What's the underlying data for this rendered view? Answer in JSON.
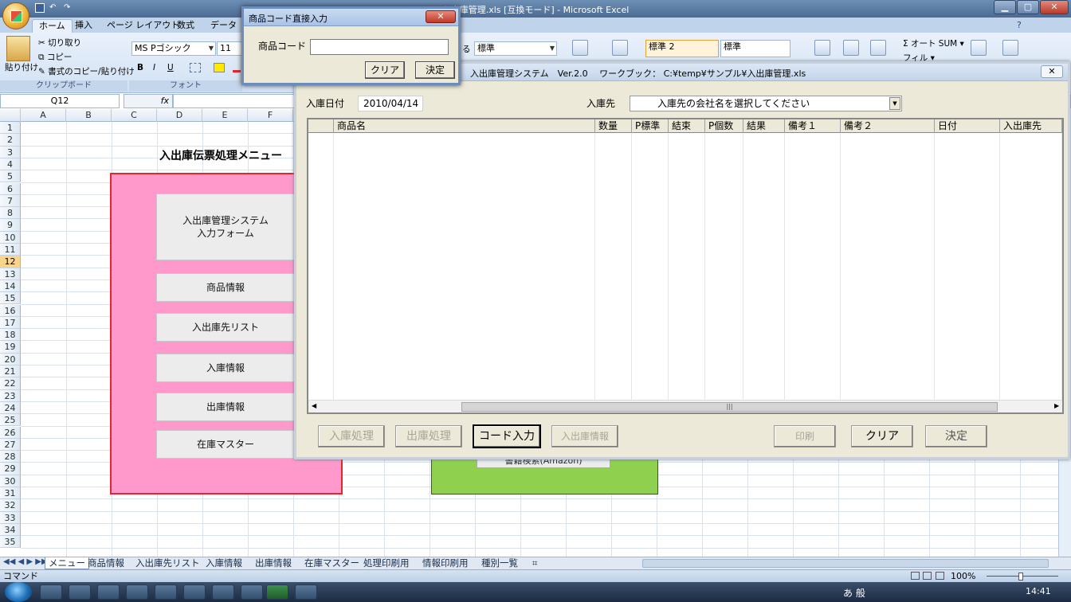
{
  "window": {
    "title": "入出庫管理.xls [互換モード] - Microsoft Excel",
    "min": "▁",
    "max": "▢",
    "close": "✕"
  },
  "ribbon": {
    "tabs": [
      "ホーム",
      "挿入",
      "ページ レイアウト",
      "数式",
      "データ"
    ],
    "clipboard": {
      "paste": "貼り付け",
      "cut": "切り取り",
      "copy": "コピー",
      "format_painter": "書式のコピー/貼り付け",
      "group": "クリップボード"
    },
    "font": {
      "name": "MS Pゴシック",
      "size": "11",
      "group": "フォント",
      "bold": "B",
      "italic": "I",
      "underline": "U"
    },
    "number": {
      "format": "標準",
      "partial": "る"
    },
    "styles": {
      "style1": "標準 2",
      "style2": "標準"
    },
    "editing": {
      "autosum": "Σ オート SUM ▾",
      "fill": "フィル ▾"
    }
  },
  "formula_bar": {
    "namebox": "Q12",
    "fx": "fx"
  },
  "grid": {
    "columns": [
      "A",
      "B",
      "C",
      "D",
      "E",
      "F"
    ],
    "rows": [
      "1",
      "2",
      "3",
      "4",
      "5",
      "6",
      "7",
      "8",
      "9",
      "10",
      "11",
      "12",
      "13",
      "14",
      "15",
      "16",
      "17",
      "18",
      "19",
      "20",
      "21",
      "22",
      "23",
      "24",
      "25",
      "26",
      "27",
      "28",
      "29",
      "30",
      "31",
      "32",
      "33",
      "34",
      "35"
    ],
    "selected_row": "12"
  },
  "menu": {
    "title": "入出庫伝票処理メニュー",
    "buttons": [
      "入出庫管理システム\n入力フォーム",
      "商品情報",
      "入出庫先リスト",
      "入庫情報",
      "出庫情報",
      "在庫マスター"
    ],
    "amazon": "書籍検索(Amazon)"
  },
  "sheet_tabs": [
    "メニュー",
    "商品情報",
    "入出庫先リスト",
    "入庫情報",
    "出庫情報",
    "在庫マスター",
    "処理印刷用",
    "情報印刷用",
    "種別一覧"
  ],
  "status": {
    "mode": "コマンド",
    "zoom": "100%"
  },
  "taskbar": {
    "time": "14:41",
    "ime": "あ 般"
  },
  "main_form": {
    "title": "入出庫管理システム　Ver.2.0　 ワークブック： C:¥temp¥サンプル¥入出庫管理.xls",
    "close": "✕",
    "date_label": "入庫日付",
    "date_value": "2010/04/14",
    "dest_label": "入庫先",
    "dest_placeholder": "入庫先の会社名を選択してください",
    "columns": [
      "",
      "商品名",
      "数量",
      "P標準",
      "結束",
      "P個数",
      "結果",
      "備考１",
      "備考２",
      "日付",
      "入出庫先"
    ],
    "buttons": {
      "in": "入庫処理",
      "out": "出庫処理",
      "code": "コード入力",
      "info": "入出庫情報",
      "print": "印刷",
      "clear": "クリア",
      "ok": "決定"
    }
  },
  "dialog": {
    "title": "商品コード直接入力",
    "close": "✕",
    "code_label": "商品コード",
    "code_value": "",
    "clear": "クリア",
    "ok": "決定"
  }
}
